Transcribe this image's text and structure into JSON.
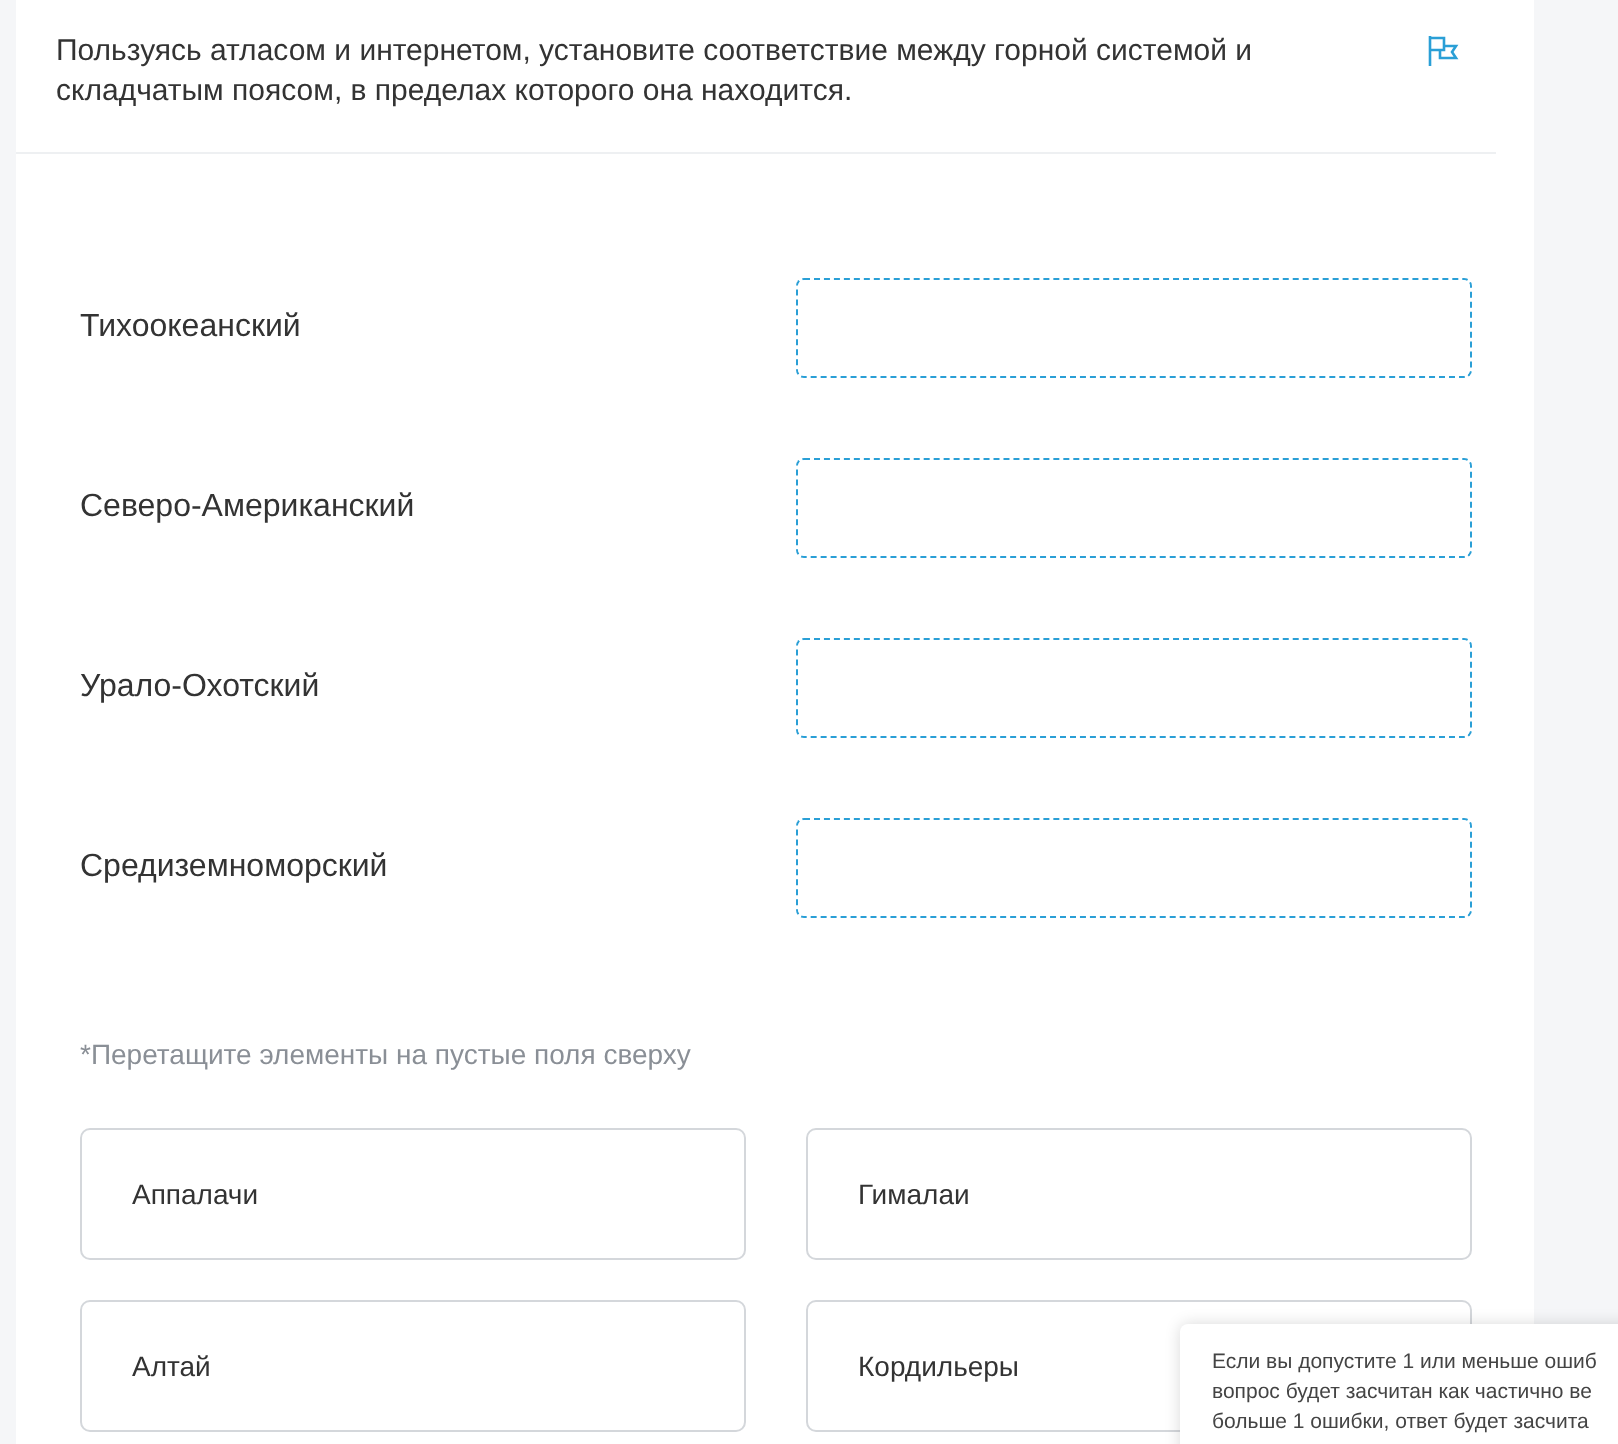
{
  "question": "Пользуясь атласом и интернетом, установите соответствие между горной системой и складчатым поясом, в пределах которого она находится.",
  "pairs": [
    {
      "label": "Тихоокеанский"
    },
    {
      "label": "Северо-Американский"
    },
    {
      "label": "Урало-Охотский"
    },
    {
      "label": "Средиземноморский"
    }
  ],
  "hint": "*Перетащите элементы на пустые поля сверху",
  "options": [
    {
      "label": "Аппалачи"
    },
    {
      "label": "Гималаи"
    },
    {
      "label": "Алтай"
    },
    {
      "label": "Кордильеры"
    }
  ],
  "tooltip": {
    "lines": [
      "Если вы допустите 1 или меньше ошиб",
      "вопрос будет засчитан как частично ве",
      "больше 1 ошибки, ответ будет засчита"
    ]
  }
}
